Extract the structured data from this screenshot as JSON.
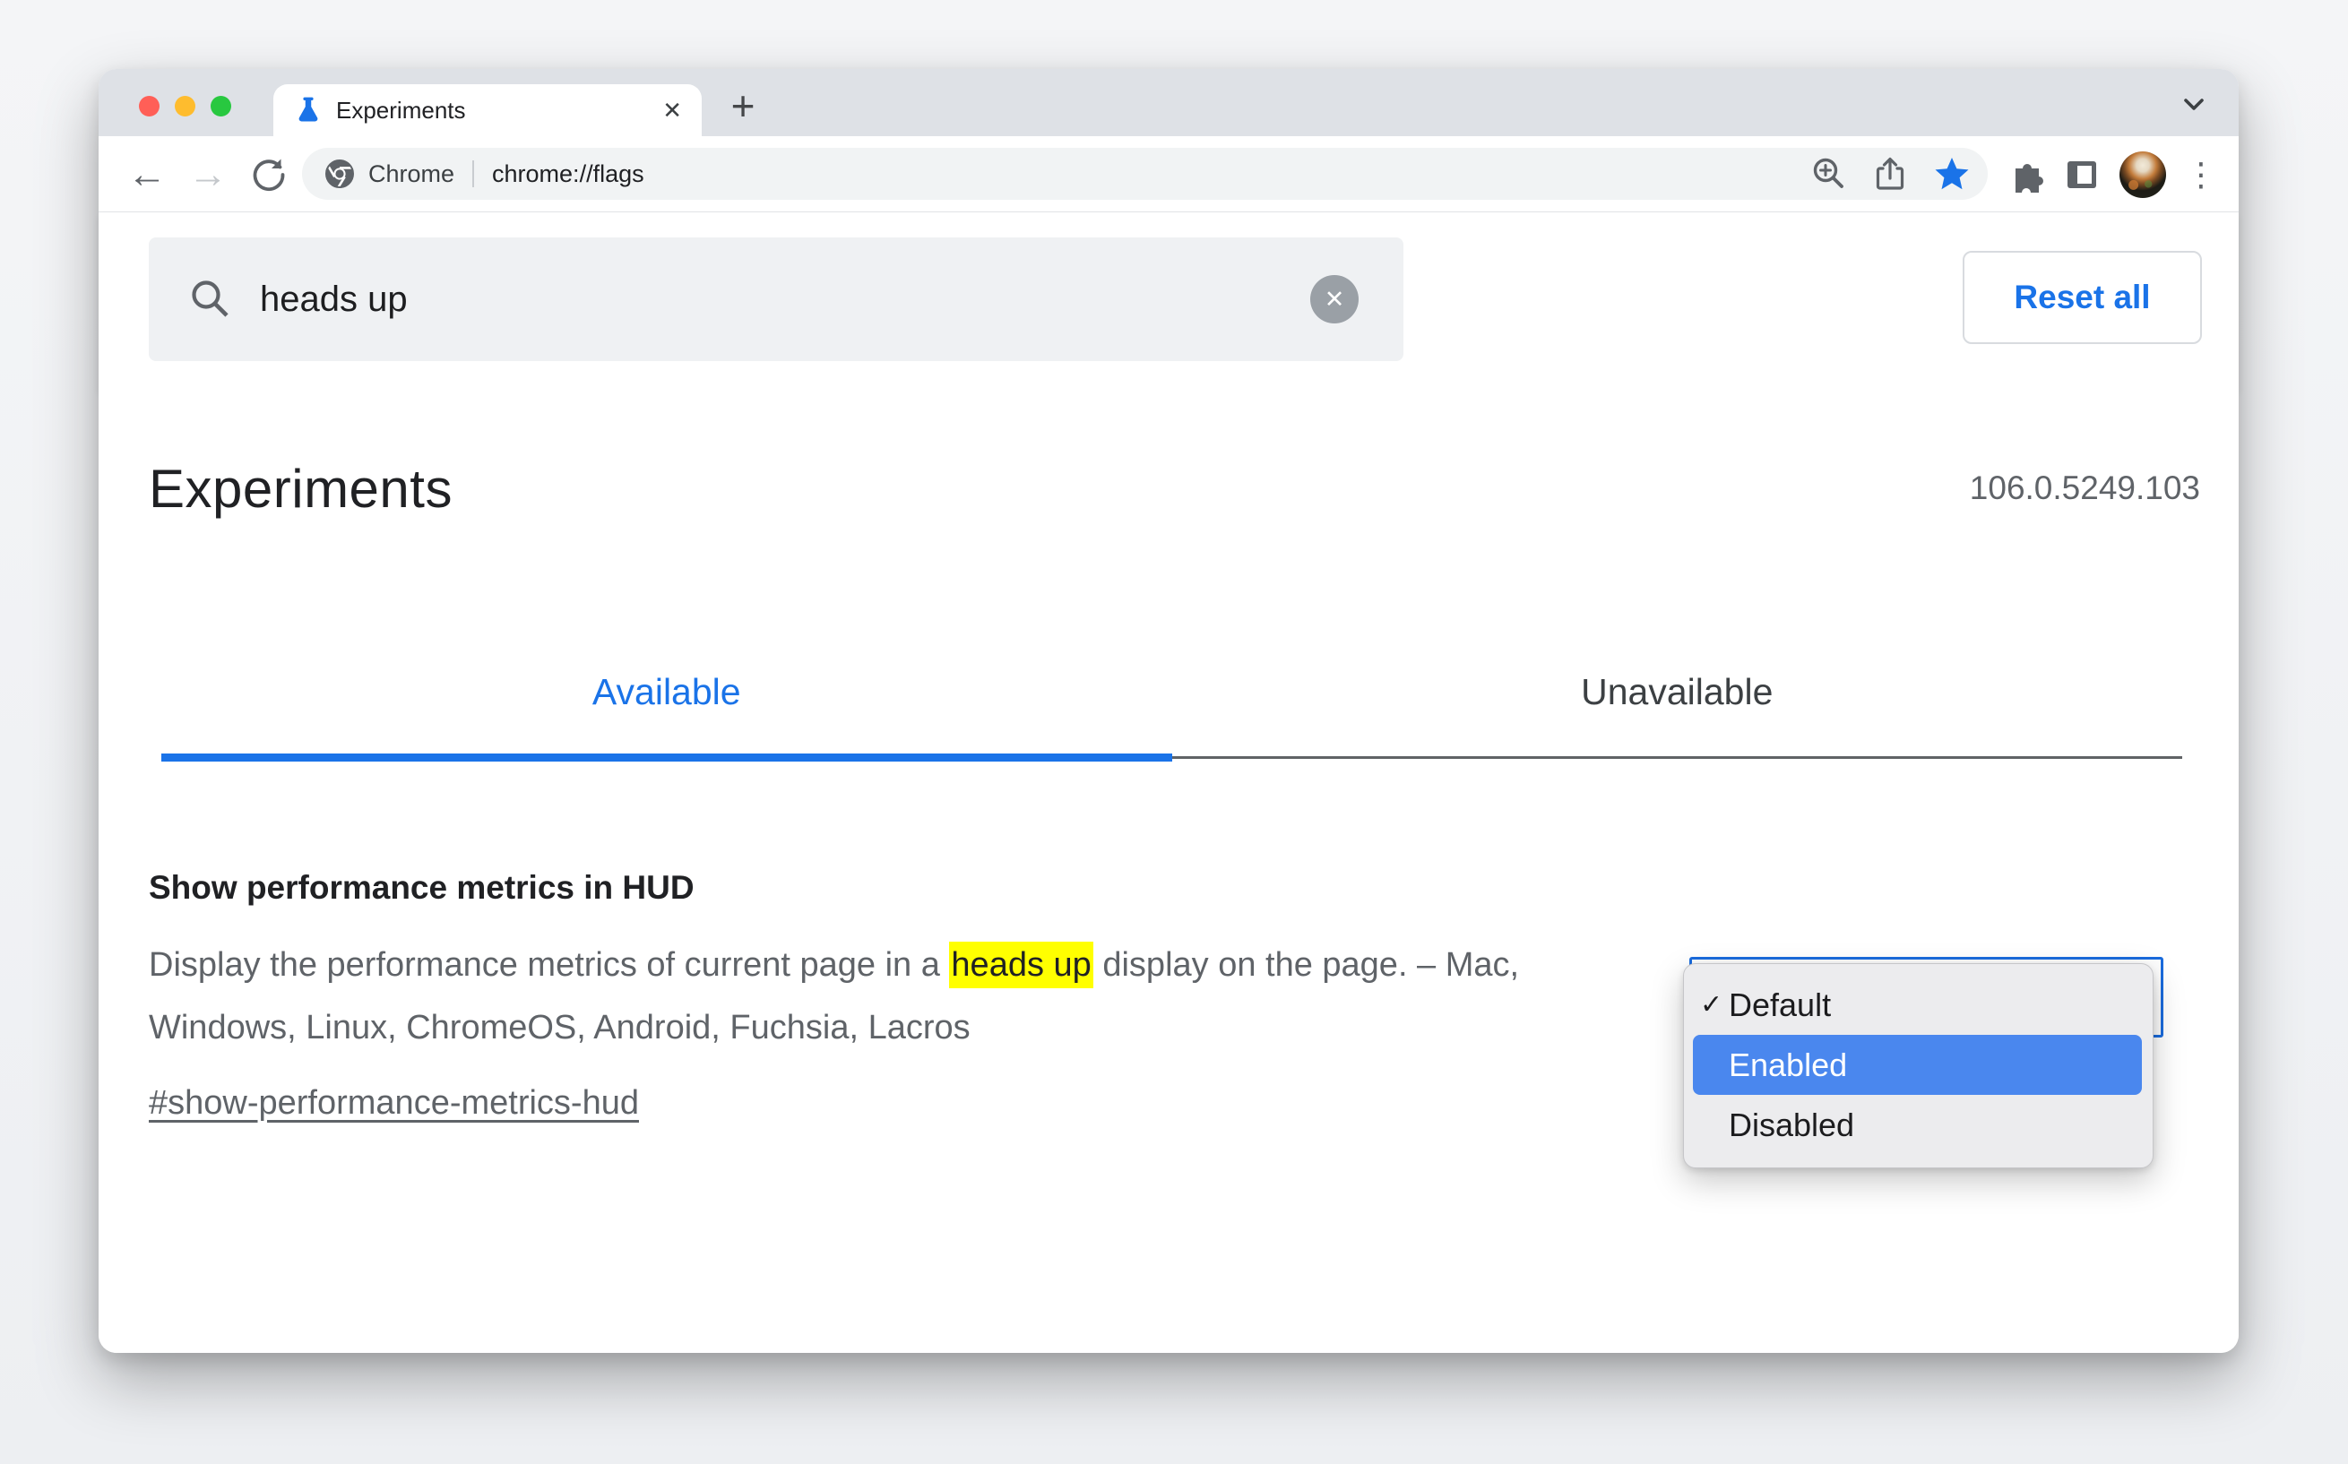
{
  "window": {
    "tab_title": "Experiments",
    "close_glyph": "✕",
    "new_tab_glyph": "+",
    "address": {
      "site": "Chrome",
      "url": "chrome://flags"
    }
  },
  "toolbar_icons": {
    "back": "←",
    "forward": "→",
    "kebab": "⋮"
  },
  "flags_toolbar": {
    "search_value": "heads up",
    "clear_glyph": "✕",
    "reset_button": "Reset all"
  },
  "page": {
    "title": "Experiments",
    "version": "106.0.5249.103",
    "tabs": [
      {
        "label": "Available"
      },
      {
        "label": "Unavailable"
      }
    ],
    "flag": {
      "name": "Show performance metrics in HUD",
      "desc_before": "Display the performance metrics of current page in a ",
      "desc_highlight": "heads up",
      "desc_after": " display on the page. – Mac, Windows, Linux, ChromeOS, Android, Fuchsia, Lacros",
      "permalink": "#show-performance-metrics-hud"
    },
    "dropdown": {
      "check_glyph": "✓",
      "options": [
        {
          "label": "Default"
        },
        {
          "label": "Enabled"
        },
        {
          "label": "Disabled"
        }
      ]
    }
  },
  "colors": {
    "accent": "#1a73e8",
    "menu_selection": "#4a87ee",
    "search_highlight": "#ffff00"
  }
}
